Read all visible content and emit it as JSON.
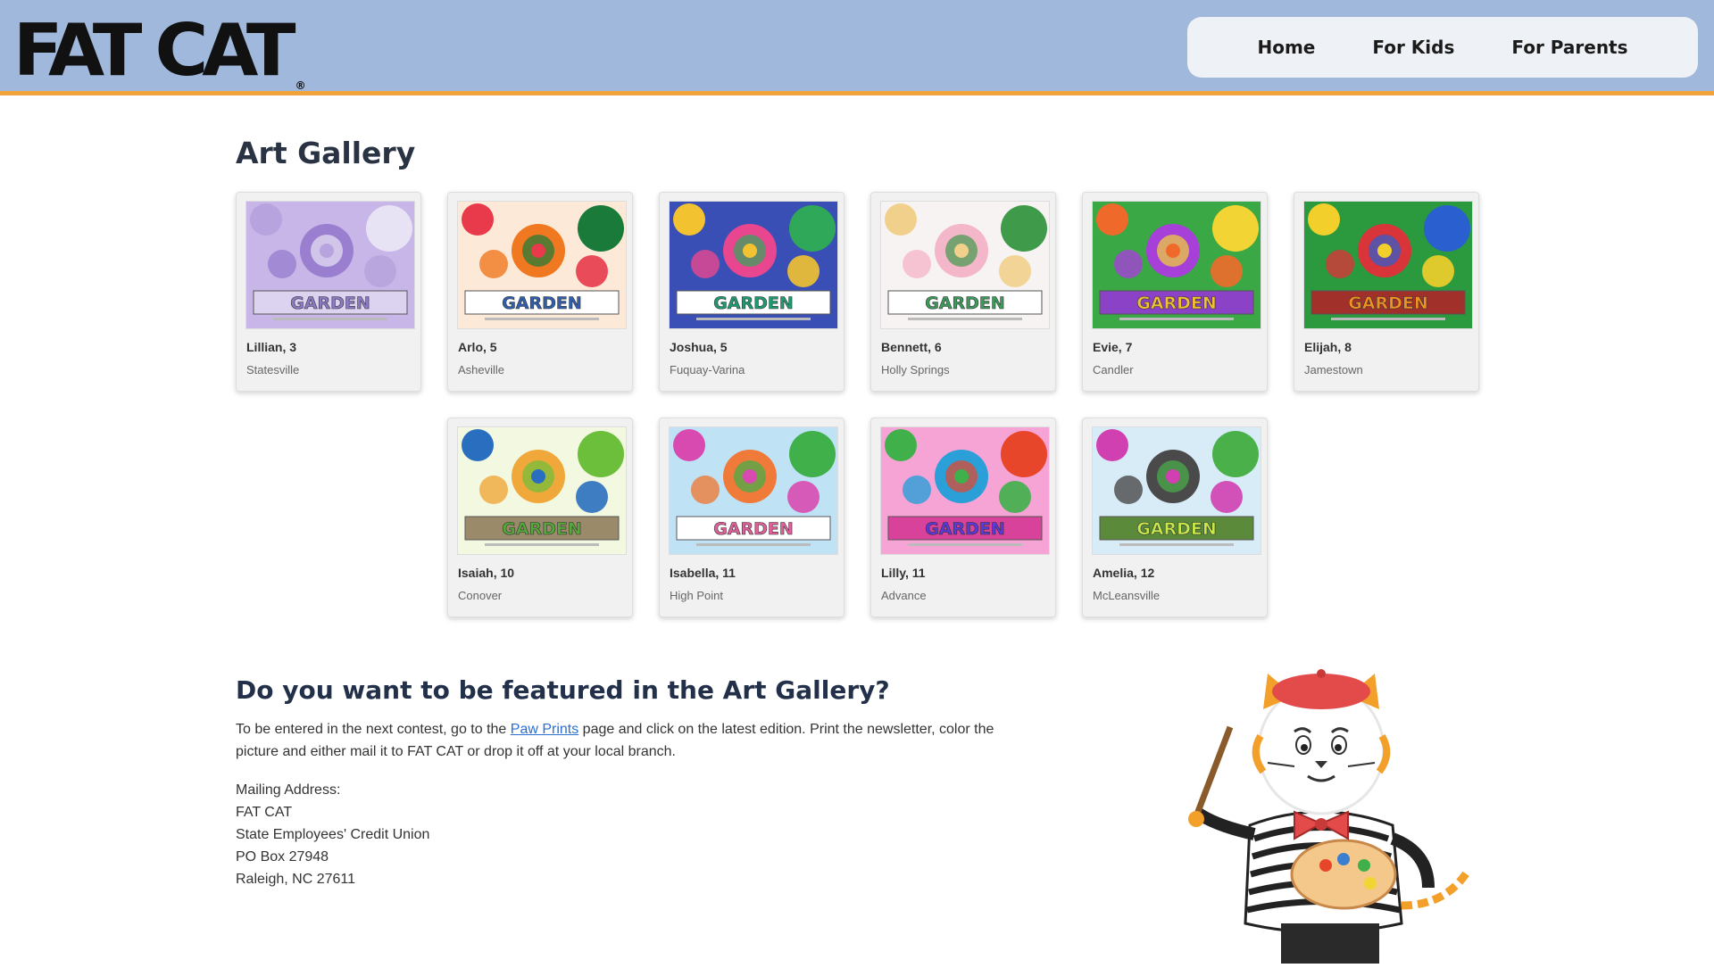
{
  "brand": {
    "logo_text": "FAT CAT",
    "trademark": "®"
  },
  "nav": {
    "items": [
      "Home",
      "For Kids",
      "For Parents"
    ]
  },
  "page_title": "Art Gallery",
  "artworks": [
    {
      "name": "Lillian, 3",
      "city": "Statesville"
    },
    {
      "name": "Arlo, 5",
      "city": "Asheville"
    },
    {
      "name": "Joshua, 5",
      "city": "Fuquay-Varina"
    },
    {
      "name": "Bennett, 6",
      "city": "Holly Springs"
    },
    {
      "name": "Evie, 7",
      "city": "Candler"
    },
    {
      "name": "Elijah, 8",
      "city": "Jamestown"
    },
    {
      "name": "Isaiah, 10",
      "city": "Conover"
    },
    {
      "name": "Isabella, 11",
      "city": "High Point"
    },
    {
      "name": "Lilly, 11",
      "city": "Advance"
    },
    {
      "name": "Amelia, 12",
      "city": "McLeansville"
    }
  ],
  "art_label": "GARDEN",
  "feature": {
    "title": "Do you want to be featured in the Art Gallery?",
    "text_before": "To be entered in the next contest, go to the ",
    "link": "Paw Prints",
    "text_after": " page and click on the latest edition. Print the newsletter, color the picture and either mail it to FAT CAT or drop it off at your local branch."
  },
  "mailing": {
    "label": "Mailing Address:",
    "lines": [
      "FAT CAT",
      "State Employees' Credit Union",
      "PO Box 27948",
      "Raleigh, NC 27611"
    ]
  },
  "colors": {
    "header_bg": "#a0b8db",
    "header_border": "#f0a33a",
    "nav_bg": "#eef1f6",
    "link": "#2a6fd1"
  },
  "art_palettes": [
    {
      "bg": "#c8b6e8",
      "accent1": "#9a7fd0",
      "accent2": "#e8e2f5",
      "accent3": "#b7a4de",
      "band": "#dcd3f0",
      "text": "#8c7ac4"
    },
    {
      "bg": "#fde9d8",
      "accent1": "#f07820",
      "accent2": "#1a7a3a",
      "accent3": "#e83a4a",
      "band": "#ffffff",
      "text": "#2f5fae"
    },
    {
      "bg": "#3a4fb5",
      "accent1": "#e8478f",
      "accent2": "#2fa85a",
      "accent3": "#f2c230",
      "band": "#ffffff",
      "text": "#1f9a72"
    },
    {
      "bg": "#f8f3f3",
      "accent1": "#f4b6c9",
      "accent2": "#3f9a4a",
      "accent3": "#f1d08c",
      "band": "#ffffff",
      "text": "#3c9a5a"
    },
    {
      "bg": "#3aa845",
      "accent1": "#a640d8",
      "accent2": "#f2d534",
      "accent3": "#ef6a2a",
      "band": "#8b42c6",
      "text": "#f0c030"
    },
    {
      "bg": "#2b9a3f",
      "accent1": "#d8343a",
      "accent2": "#2a5fd0",
      "accent3": "#f2cf2a",
      "band": "#a1302a",
      "text": "#f09020"
    },
    {
      "bg": "#f3f9e0",
      "accent1": "#f0a83a",
      "accent2": "#6bbf3a",
      "accent3": "#2a6fbf",
      "band": "#9a8a6a",
      "text": "#55a83a"
    },
    {
      "bg": "#bfe3f5",
      "accent1": "#ef7a3a",
      "accent2": "#3fb04a",
      "accent3": "#d84ab0",
      "band": "#ffffff",
      "text": "#e0609a"
    },
    {
      "bg": "#f6a3d6",
      "accent1": "#2a9fd8",
      "accent2": "#e8462a",
      "accent3": "#3fb04a",
      "band": "#d9429a",
      "text": "#5a3ad8"
    },
    {
      "bg": "#d8ecf8",
      "accent1": "#4a4a4a",
      "accent2": "#4ab04a",
      "accent3": "#d040b0",
      "band": "#5a8a3a",
      "text": "#c8e84a"
    }
  ]
}
